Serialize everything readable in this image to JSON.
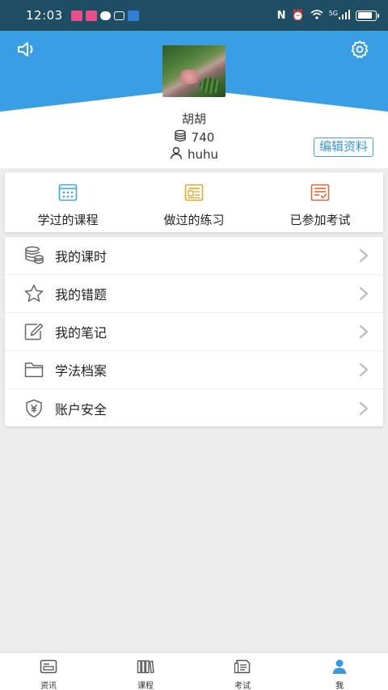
{
  "status_bar": {
    "time": "12:03",
    "network_label": "5G"
  },
  "profile": {
    "name": "胡胡",
    "coins": "740",
    "account": "huhu",
    "edit_label": "编辑资料"
  },
  "quick_links": [
    {
      "label": "学过的课程",
      "icon": "calendar-grid-icon",
      "color": "#3fa6d6"
    },
    {
      "label": "做过的练习",
      "icon": "document-icon",
      "color": "#e0a82e"
    },
    {
      "label": "已参加考试",
      "icon": "checklist-icon",
      "color": "#e0653a"
    }
  ],
  "menu": [
    {
      "label": "我的课时",
      "icon": "coins-stack-icon"
    },
    {
      "label": "我的错题",
      "icon": "star-icon"
    },
    {
      "label": "我的笔记",
      "icon": "edit-note-icon"
    },
    {
      "label": "学法档案",
      "icon": "folder-icon"
    },
    {
      "label": "账户安全",
      "icon": "shield-yen-icon"
    }
  ],
  "tabs": [
    {
      "label": "资讯",
      "icon": "news-icon",
      "active": false
    },
    {
      "label": "课程",
      "icon": "books-icon",
      "active": false
    },
    {
      "label": "考试",
      "icon": "exam-icon",
      "active": false
    },
    {
      "label": "我",
      "icon": "person-icon",
      "active": true
    }
  ],
  "colors": {
    "header_blue": "#3a9ee4",
    "accent": "#4a9fd8",
    "status_bar": "#1f4d63"
  }
}
